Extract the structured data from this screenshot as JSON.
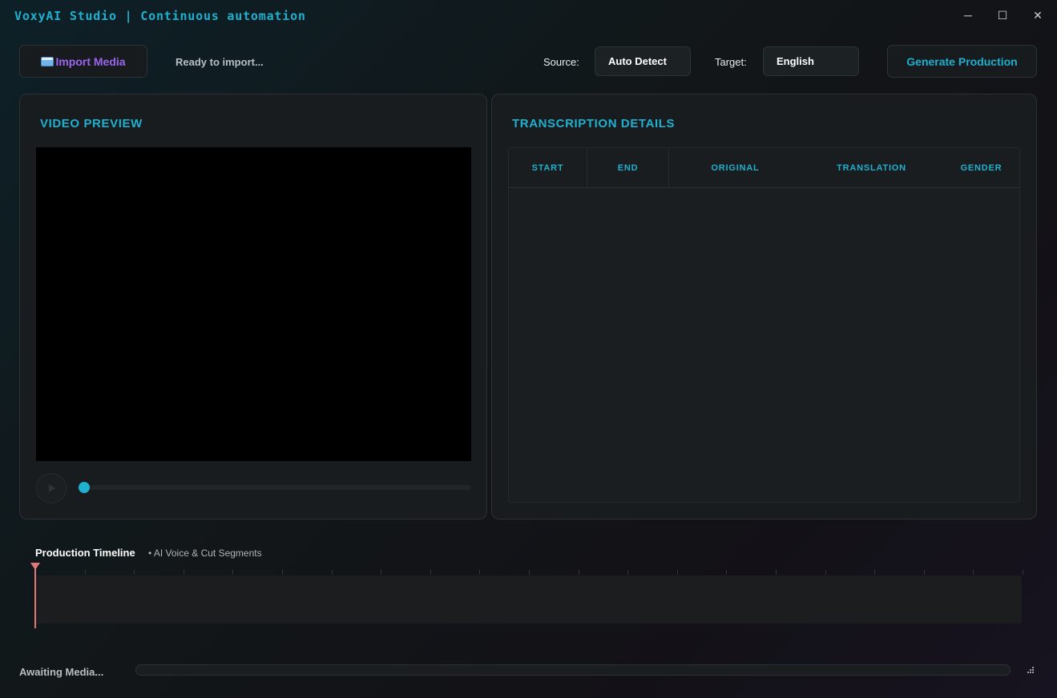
{
  "window": {
    "title": "VoxyAI Studio | Continuous automation",
    "controls": {
      "minimize": "─",
      "maximize": "☐",
      "close": "✕"
    }
  },
  "toolbar": {
    "import_label": "Import Media",
    "import_icon": "folder-icon",
    "status": "Ready to import...",
    "source_label": "Source:",
    "source_value": "Auto Detect",
    "target_label": "Target:",
    "target_value": "English",
    "generate_label": "Generate Production"
  },
  "video": {
    "title": "VIDEO PREVIEW",
    "progress": 0
  },
  "transcription": {
    "title": "TRANSCRIPTION DETAILS",
    "columns": [
      "START",
      "END",
      "ORIGINAL",
      "TRANSLATION",
      "GENDER"
    ],
    "rows": []
  },
  "timeline": {
    "title": "Production Timeline",
    "subtitle": "• AI Voice & Cut Segments"
  },
  "footer": {
    "status": "Awaiting Media...",
    "progress": 0
  },
  "colors": {
    "accent": "#1fb0cf",
    "import_accent": "#9b66f0",
    "playhead": "#e27777"
  }
}
